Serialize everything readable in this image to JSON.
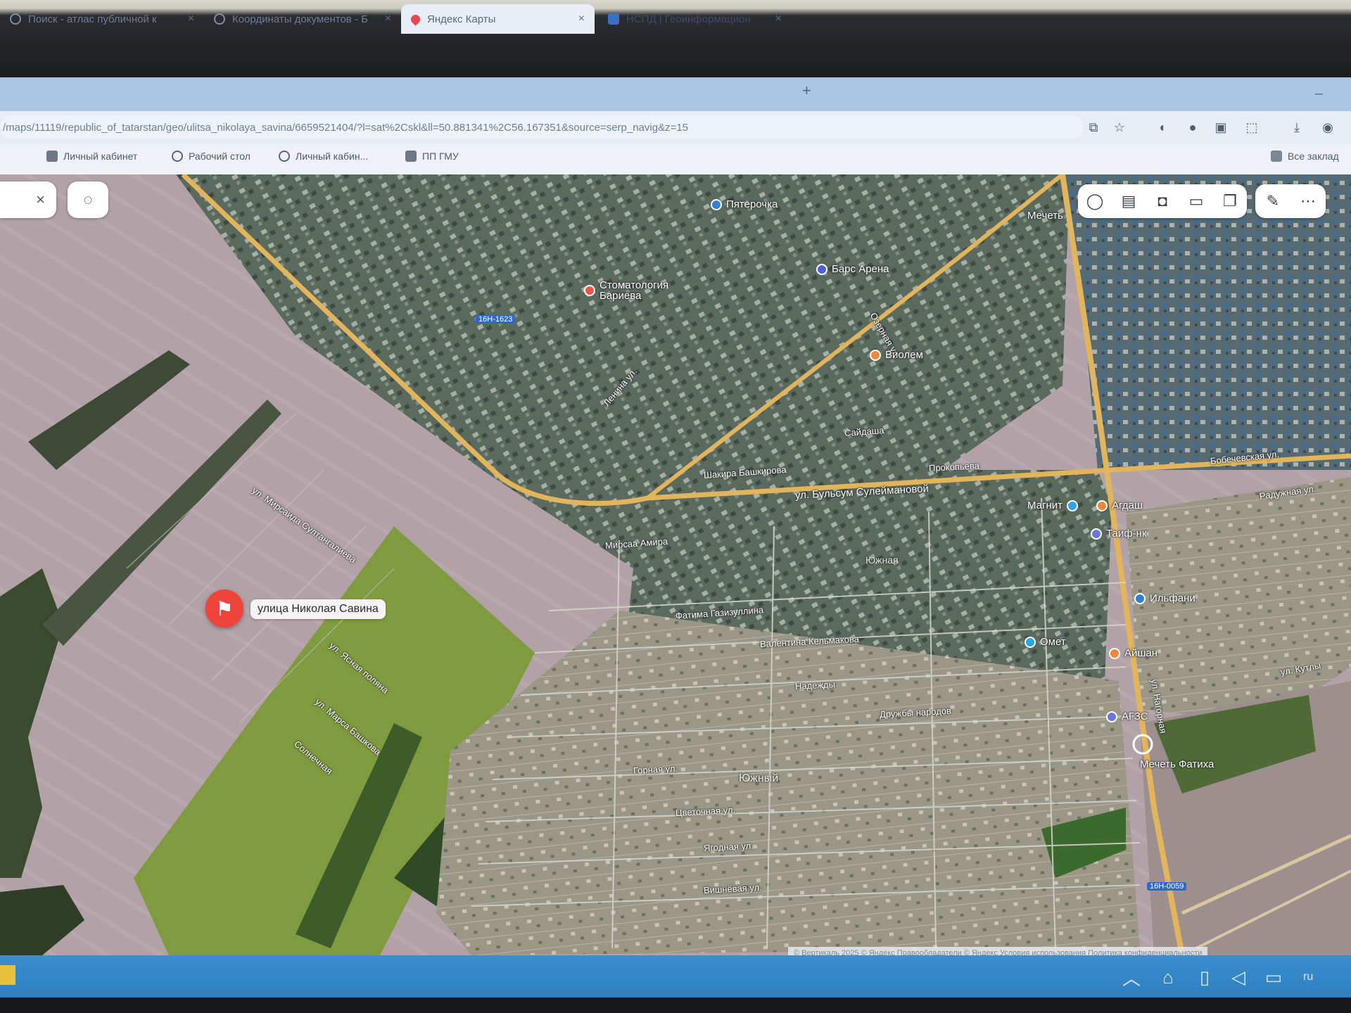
{
  "browser": {
    "tabs": [
      {
        "label": "Поиск - атлас публичной к",
        "state": "normal"
      },
      {
        "label": "Координаты документов - Б",
        "state": "normal"
      },
      {
        "label": "Яндекс Карты",
        "state": "active"
      },
      {
        "label": "НСПД | Геоинформацион",
        "state": "blue"
      }
    ],
    "new_tab_glyph": "+",
    "address": "/maps/11119/republic_of_tatarstan/geo/ulitsa_nikolaya_savina/665952140​4/?l=sat%2Cskl&ll=50.881341%2C56.167351&source=serp_navig&z=15",
    "bookmarks": [
      {
        "label": "Личный кабинет",
        "icon": "square-icon"
      },
      {
        "label": "Рабочий стол",
        "icon": "globe-icon"
      },
      {
        "label": "Личный кабин...",
        "icon": "globe-icon"
      },
      {
        "label": "ПП ГМУ",
        "icon": "shield-icon"
      }
    ],
    "all_bookmarks": "Все заклад"
  },
  "map": {
    "poi": [
      {
        "name": "Пятерочка",
        "color": "#2f7fd6"
      },
      {
        "name": "Стоматология Бариева",
        "color": "#e9584f"
      },
      {
        "name": "Барс Арена",
        "color": "#4d5fe0"
      },
      {
        "name": "Виолем",
        "color": "#f0883a"
      },
      {
        "name": "Магнит",
        "color": "#2aa6e8"
      },
      {
        "name": "Агдаш",
        "color": "#f0883a"
      },
      {
        "name": "Таиф-нк",
        "color": "#6c74e0"
      },
      {
        "name": "Ильфани",
        "color": "#2f7fd6"
      },
      {
        "name": "Омет",
        "color": "#2aa6e8"
      },
      {
        "name": "Айшан",
        "color": "#f0883a"
      },
      {
        "name": "АГЗС",
        "color": "#6c74e0"
      },
      {
        "name": "Мечеть Фатиха",
        "color": "#ffffff"
      },
      {
        "name": "Мечеть",
        "color": "#ffffff"
      }
    ],
    "streets": [
      "ул. Бульсум Сулеймановой",
      "Мирсаа Амира",
      "Фатима Газизуллина",
      "Валентина Кельмакова",
      "Надежды",
      "Дружбы народов",
      "Горная ул.",
      "Цветочная ул.",
      "Ягодная ул.",
      "Вишнёвая ул.",
      "Южный",
      "Шакира Башкирова",
      "Сайдаша",
      "Прокопьева",
      "Южная",
      "Радужная ул.",
      "ул. Кутлы",
      "ул. Нагорная",
      "Бобечевская ул.",
      "ул. Ясная поляна",
      "ул. Марса Башкова",
      "Солнечная",
      "ул. Мирсаида Султангалиева",
      "Ленина ул.",
      "Озерная ул."
    ],
    "road_shields": [
      "16Н-1623",
      "16Н-0059"
    ],
    "pin_label": "улица Николая Савина",
    "pin_glyph": "⚑",
    "copyright": "© Вертикаль 2025 © Яндекс  Правообладатели      © Яндекс  Условия использования   Политика конфиденциальности"
  },
  "taskbar": {
    "lang": "ru",
    "tray": [
      "chevron-up-icon",
      "gamepad-icon",
      "usb-icon",
      "speaker-muted-icon",
      "monitor-icon"
    ]
  }
}
